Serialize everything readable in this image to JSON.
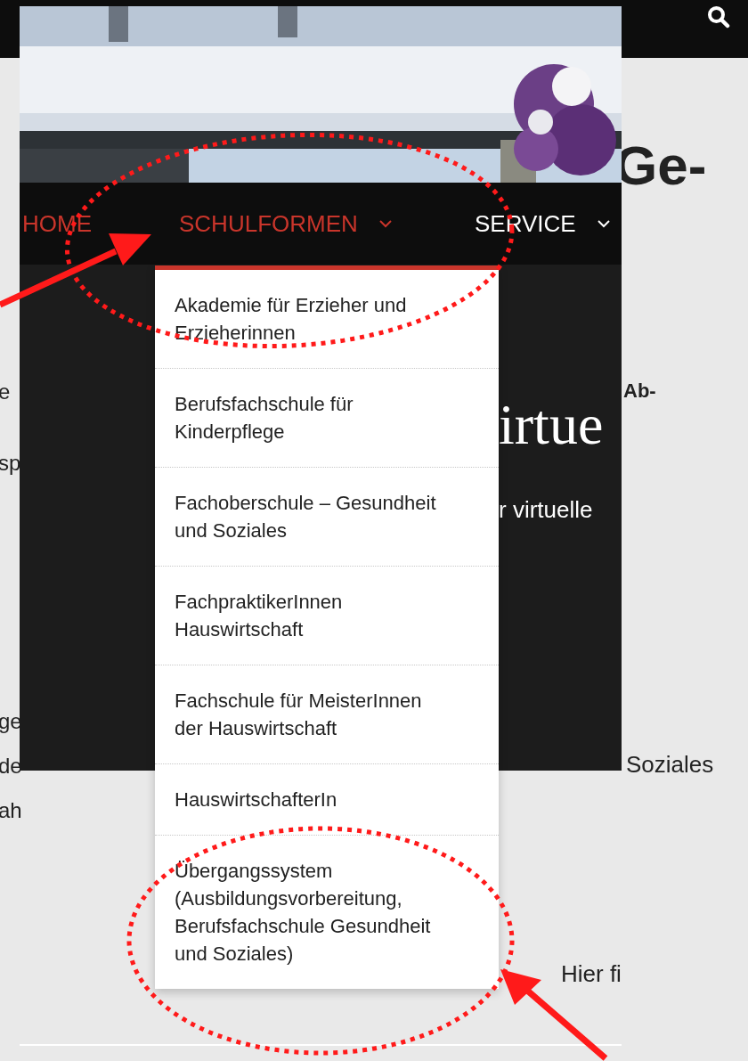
{
  "background_page": {
    "heading_right": "Ge-",
    "left_fragments": [
      "e",
      "sp",
      "ge",
      "de",
      "ah"
    ],
    "right_fragments": [
      "Ab-",
      "Soziales",
      "Hier fi"
    ]
  },
  "overlay": {
    "nav": [
      {
        "label": "HOME",
        "highlighted": true,
        "has_submenu": false
      },
      {
        "label": "SCHULFORMEN",
        "highlighted": true,
        "has_submenu": true
      },
      {
        "label": "SERVICE",
        "highlighted": false,
        "has_submenu": true
      }
    ],
    "hero_title": "irtue",
    "hero_subtitle": "r virtuelle",
    "dropdown": [
      "Akademie für Erzieher und\nErzieherinnen",
      "Berufsfachschule für\nKinderpflege",
      "Fachoberschule – Gesundheit\nund Soziales",
      "FachpraktikerInnen\nHauswirtschaft",
      "Fachschule für MeisterInnen\nder Hauswirtschaft",
      "HauswirtschafterIn",
      "Übergangssystem\n(Ausbildungsvorbereitung,\nBerufsfachschule Gesundheit\nund Soziales)"
    ]
  }
}
